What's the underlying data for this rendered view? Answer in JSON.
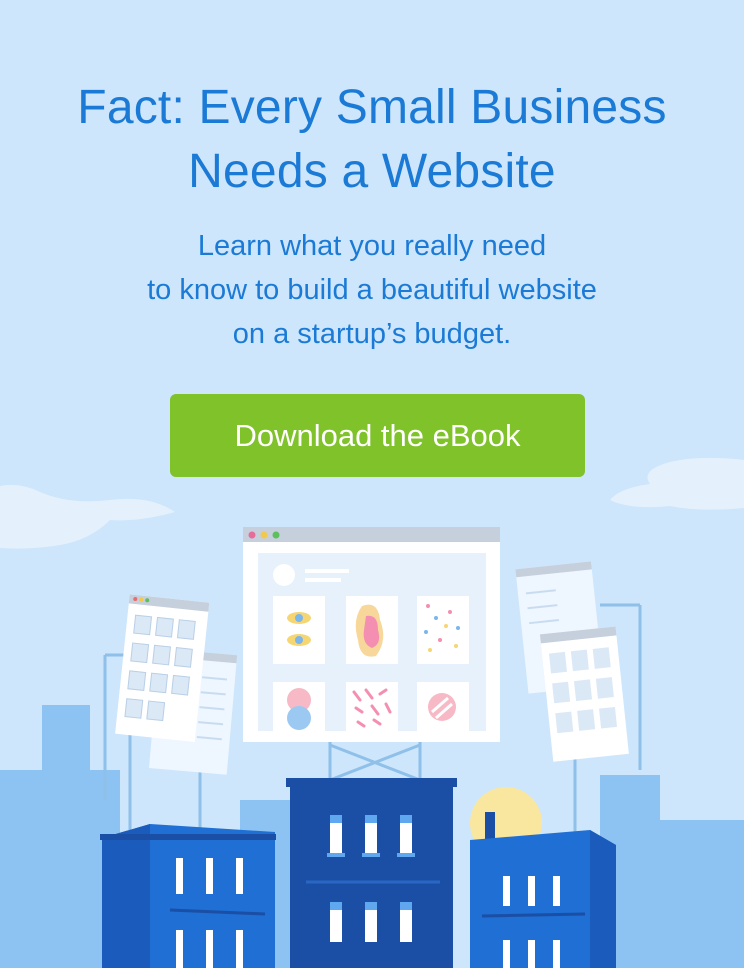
{
  "headline": {
    "line1": "Fact: Every Small Business",
    "line2": "Needs a Website"
  },
  "subhead": {
    "line1": "Learn what you really need",
    "line2": "to know to build a beautiful website",
    "line3": "on a startup’s budget."
  },
  "cta": {
    "label": "Download the eBook"
  },
  "colors": {
    "background": "#cde6fb",
    "headline_text": "#1b7ad6",
    "cta_button": "#80c22a",
    "building_dark": "#1a4fa5",
    "building_mid": "#1f6fd4",
    "sun": "#f9e7a0"
  },
  "illustration": {
    "icons": [
      "browser-window-icon",
      "eye-icon",
      "gallery-grid-icon",
      "city-buildings-icon",
      "sun-icon",
      "cloud-icon"
    ]
  }
}
